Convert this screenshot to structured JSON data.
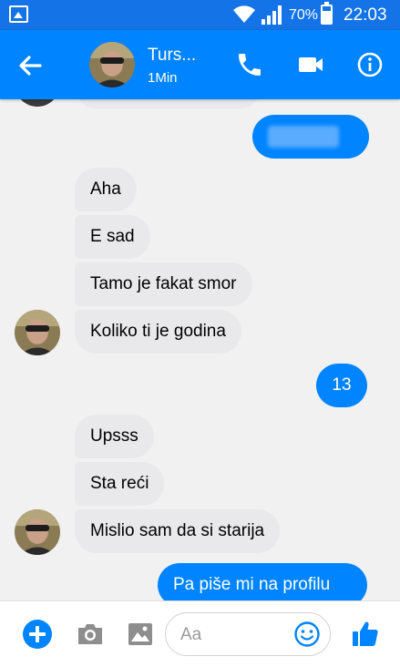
{
  "status_bar": {
    "battery": "70%",
    "battery_level": 0.7,
    "time": "22:03"
  },
  "header": {
    "contact_name": "Turs...",
    "contact_status": "1Min"
  },
  "messages": [
    {
      "side": "out",
      "text": "",
      "blurred": true
    },
    {
      "side": "in",
      "text": "Aha"
    },
    {
      "side": "in",
      "text": "E sad"
    },
    {
      "side": "in",
      "text": "Tamo je fakat smor"
    },
    {
      "side": "in",
      "text": "Koliko ti je godina"
    },
    {
      "side": "out",
      "text": "13"
    },
    {
      "side": "in",
      "text": "Upsss"
    },
    {
      "side": "in",
      "text": "Sta reći"
    },
    {
      "side": "in",
      "text": "Mislio sam da si starija"
    },
    {
      "side": "out",
      "text": "Pa piše mi na profilu"
    }
  ],
  "composer": {
    "placeholder": "Aa"
  },
  "colors": {
    "accent": "#0084ff",
    "status_bar": "#1473e6",
    "incoming_bubble": "#e9e9eb"
  },
  "icons": {
    "status_bar": [
      "gallery-icon",
      "wifi-icon",
      "signal-icon",
      "battery-icon"
    ],
    "header": [
      "back-arrow-icon",
      "phone-icon",
      "video-icon",
      "info-icon"
    ],
    "composer": [
      "plus-icon",
      "camera-icon",
      "image-icon",
      "emoji-icon",
      "thumbs-up-icon"
    ]
  }
}
